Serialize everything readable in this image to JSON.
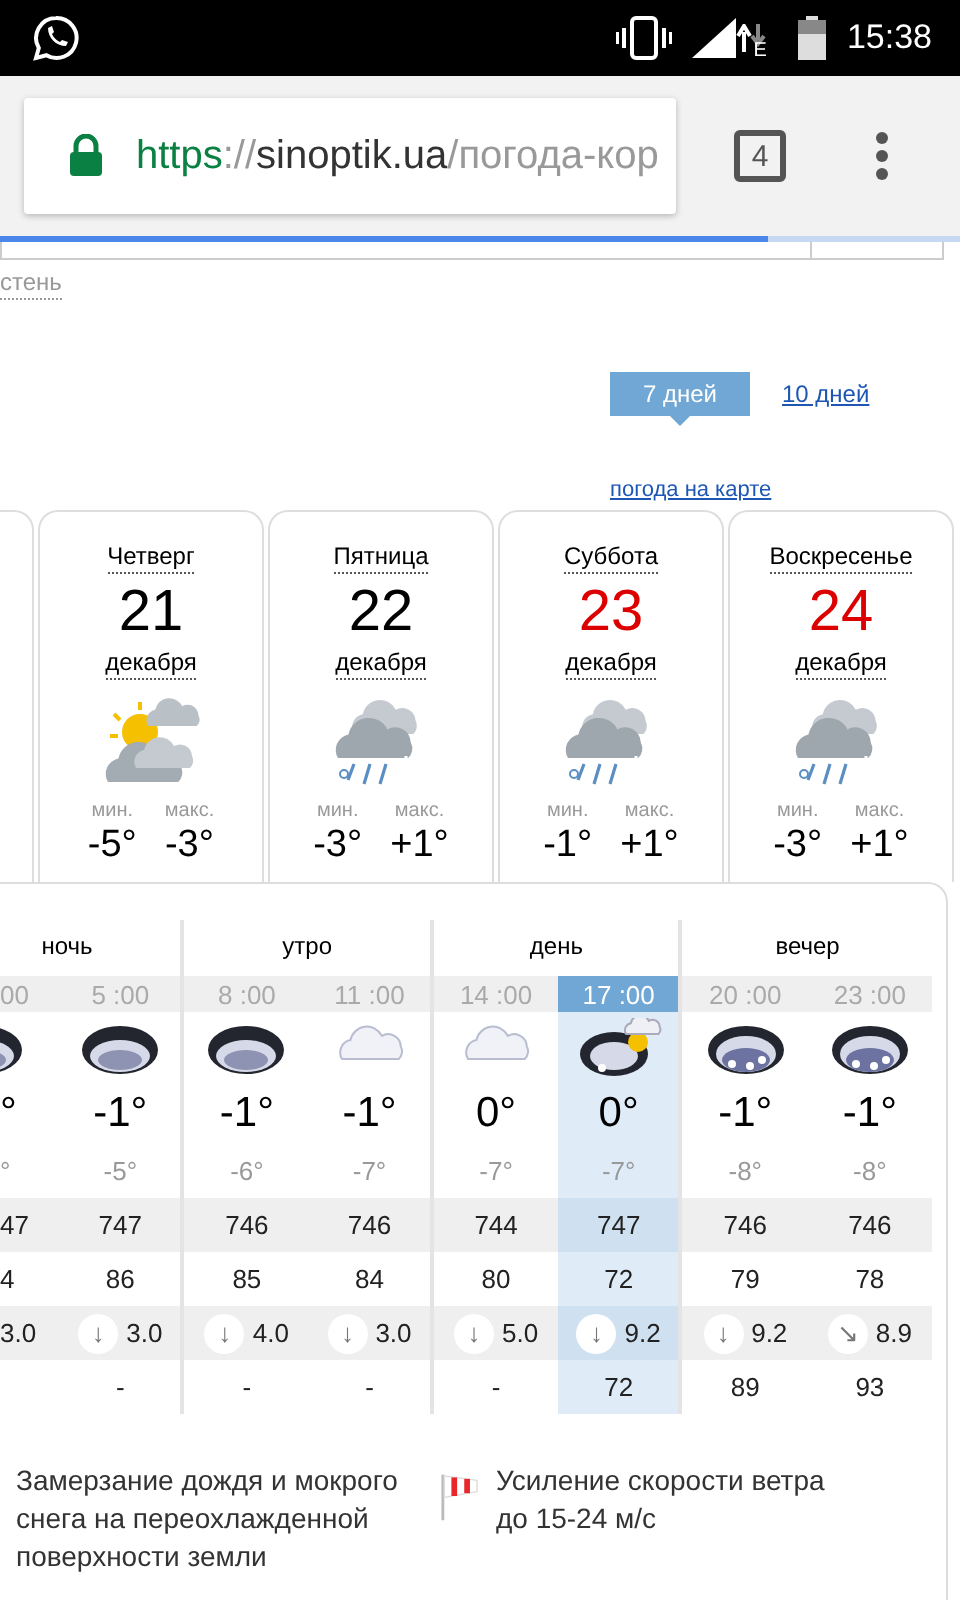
{
  "status_bar": {
    "network_type": "E",
    "time": "15:38"
  },
  "browser": {
    "url": {
      "scheme": "https",
      "separator": "://",
      "host": "sinoptik.ua",
      "path": "/погода-кор"
    },
    "tab_count": "4",
    "loading": {
      "level": 0.8
    }
  },
  "page": {
    "breadcrumb": "стень",
    "tabs": [
      {
        "label": "7 дней",
        "selected": true
      },
      {
        "label": "10 дней",
        "selected": false
      }
    ],
    "map_link": "погода на карте"
  },
  "days": [
    {
      "weekday": "Четверг",
      "date": "21",
      "month": "декабря",
      "weekend": false,
      "kind": "sun-cloud",
      "min_label": "мин.",
      "min": "-5°",
      "max_label": "макс.",
      "max": "-3°"
    },
    {
      "weekday": "Пятница",
      "date": "22",
      "month": "декабря",
      "weekend": false,
      "kind": "snow-rain",
      "min_label": "мин.",
      "min": "-3°",
      "max_label": "макс.",
      "max": "+1°"
    },
    {
      "weekday": "Суббота",
      "date": "23",
      "month": "декабря",
      "weekend": true,
      "kind": "snow-rain",
      "min_label": "мин.",
      "min": "-1°",
      "max_label": "макс.",
      "max": "+1°"
    },
    {
      "weekday": "Воскресенье",
      "date": "24",
      "month": "декабря",
      "weekend": true,
      "kind": "snow-rain",
      "min_label": "мин.",
      "min": "-3°",
      "max_label": "макс.",
      "max": "+1°"
    }
  ],
  "detail": {
    "periods": [
      "ночь",
      "утро",
      "день",
      "вечер"
    ],
    "columns": [
      {
        "time": "00",
        "kind": "cloud-dark",
        "temp": "°",
        "feels": "°",
        "pressure": "47",
        "humidity": "4",
        "wind": "3.0",
        "selected": false
      },
      {
        "time": "5 :00",
        "kind": "cloud-dark",
        "temp": "-1°",
        "feels": "-5°",
        "pressure": "747",
        "humidity": "86",
        "wind_arrow": "↓",
        "wind": "3.0",
        "precip": "-",
        "selected": false
      },
      {
        "time": "8 :00",
        "kind": "cloud-dark",
        "temp": "-1°",
        "feels": "-6°",
        "pressure": "746",
        "humidity": "85",
        "wind_arrow": "↓",
        "wind": "4.0",
        "precip": "-",
        "selected": false
      },
      {
        "time": "11 :00",
        "kind": "cloud-light",
        "temp": "-1°",
        "feels": "-7°",
        "pressure": "746",
        "humidity": "84",
        "wind_arrow": "↓",
        "wind": "3.0",
        "precip": "-",
        "selected": false
      },
      {
        "time": "14 :00",
        "kind": "cloud-light",
        "temp": "0°",
        "feels": "-7°",
        "pressure": "744",
        "humidity": "80",
        "wind_arrow": "↓",
        "wind": "5.0",
        "precip": "-",
        "selected": false
      },
      {
        "time": "17 :00",
        "kind": "cloud-sun-snow",
        "temp": "0°",
        "feels": "-7°",
        "pressure": "747",
        "humidity": "72",
        "wind_arrow": "↓",
        "wind": "9.2",
        "precip": "72",
        "selected": true
      },
      {
        "time": "20 :00",
        "kind": "cloud-snow",
        "temp": "-1°",
        "feels": "-8°",
        "pressure": "746",
        "humidity": "79",
        "wind_arrow": "↓",
        "wind": "9.2",
        "precip": "89",
        "selected": false
      },
      {
        "time": "23 :00",
        "kind": "cloud-snow",
        "temp": "-1°",
        "feels": "-8°",
        "pressure": "746",
        "humidity": "78",
        "wind_arrow": "↘",
        "wind": "8.9",
        "precip": "93",
        "selected": false
      }
    ]
  },
  "alerts": [
    {
      "kind": "freezing",
      "text": "Замерзание дождя и мокрого снега на переохлажденной поверхности земли"
    },
    {
      "kind": "wind",
      "text": "Усиление скорости ветра до 15-24 м/с"
    }
  ]
}
